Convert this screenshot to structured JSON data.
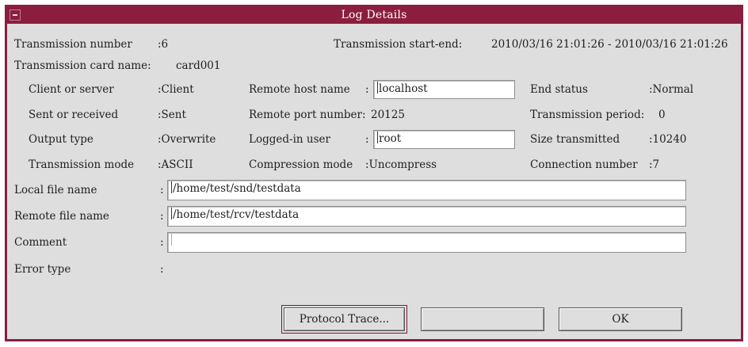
{
  "window": {
    "title": "Log Details"
  },
  "row_top": {
    "transmission_number_label": "Transmission number",
    "transmission_number_value": ":6",
    "start_end_label": "Transmission start-end:",
    "start_end_value": "2010/03/16 21:01:26 - 2010/03/16 21:01:26",
    "card_name_label": "Transmission card name:",
    "card_name_value": "card001"
  },
  "col1": {
    "client_server_label": "Client or server",
    "client_server_value": ":Client",
    "sent_received_label": "Sent or received",
    "sent_received_value": ":Sent",
    "output_type_label": "Output type",
    "output_type_value": ":Overwrite",
    "transmission_mode_label": "Transmission mode",
    "transmission_mode_value": ":ASCII"
  },
  "col2": {
    "remote_host_label": "Remote host name",
    "remote_host_colon": ":",
    "remote_host_value": "localhost",
    "remote_port_label": "Remote port number:",
    "remote_port_value": "20125",
    "logged_user_label": "Logged-in user",
    "logged_user_colon": ":",
    "logged_user_value": "root",
    "compression_label": "Compression mode",
    "compression_value": ":Uncompress"
  },
  "col3": {
    "end_status_label": "End status",
    "end_status_value": ":Normal",
    "period_label": "Transmission period:",
    "period_value": "0",
    "size_label": "Size transmitted",
    "size_value": ":10240",
    "connection_label": "Connection number",
    "connection_value": ":7"
  },
  "files": {
    "local_label": "Local file name",
    "local_colon": ":",
    "local_value": "/home/test/snd/testdata",
    "remote_label": "Remote file name",
    "remote_colon": ":",
    "remote_value": "/home/test/rcv/testdata",
    "comment_label": "Comment",
    "comment_colon": ":",
    "comment_value": "",
    "error_label": "Error type",
    "error_colon": ":"
  },
  "buttons": {
    "protocol_trace": "Protocol Trace...",
    "blank": "",
    "ok": "OK"
  },
  "colors": {
    "accent": "#8b1d3f",
    "background": "#dedede"
  }
}
